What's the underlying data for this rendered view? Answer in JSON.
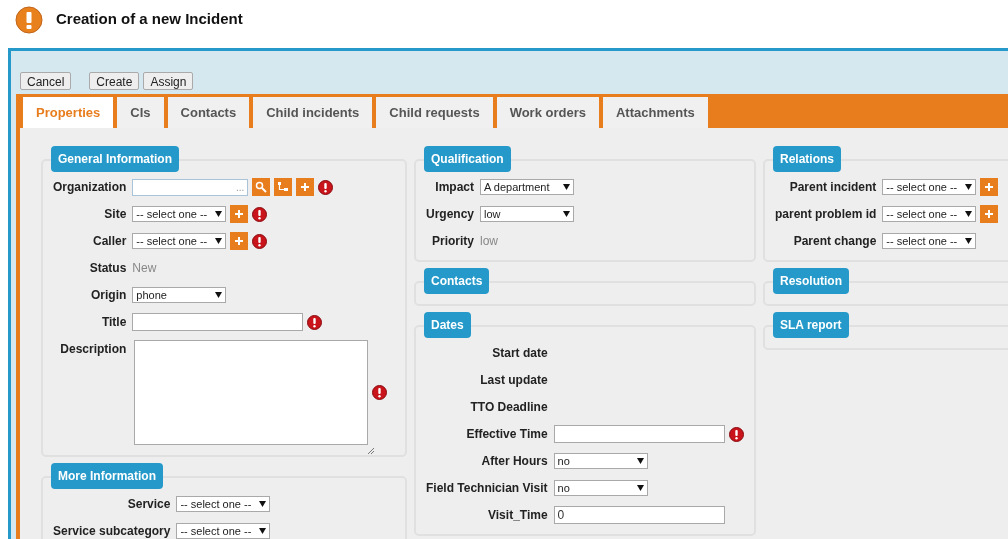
{
  "header": {
    "title": "Creation of a new Incident"
  },
  "toolbar": {
    "groups": [
      [
        "Cancel"
      ],
      [
        "Create",
        "Assign"
      ]
    ]
  },
  "tabs": [
    {
      "label": "Properties",
      "selected": true
    },
    {
      "label": "CIs",
      "selected": false
    },
    {
      "label": "Contacts",
      "selected": false
    },
    {
      "label": "Child incidents",
      "selected": false
    },
    {
      "label": "Child requests",
      "selected": false
    },
    {
      "label": "Work orders",
      "selected": false
    },
    {
      "label": "Attachments",
      "selected": false
    }
  ],
  "columns": [
    [
      {
        "title": "General Information",
        "fields": [
          {
            "label": "Organization",
            "kind": "lookup",
            "suffix": "...",
            "actions": [
              {
                "kind": "search"
              },
              {
                "kind": "tree"
              },
              {
                "kind": "add"
              }
            ],
            "required": true
          },
          {
            "label": "Site",
            "kind": "select",
            "value": "-- select one --",
            "actions": [
              {
                "kind": "add"
              }
            ],
            "required": true
          },
          {
            "label": "Caller",
            "kind": "select",
            "value": "-- select one --",
            "actions": [
              {
                "kind": "add"
              }
            ],
            "required": true
          },
          {
            "label": "Status",
            "kind": "value",
            "value": "New",
            "required": false
          },
          {
            "label": "Origin",
            "kind": "select",
            "value": "phone",
            "required": false
          },
          {
            "label": "Title",
            "kind": "text",
            "required": true
          },
          {
            "label": "Description",
            "kind": "textarea",
            "required": true
          }
        ]
      },
      {
        "title": "More Information",
        "fields": [
          {
            "label": "Service",
            "kind": "select",
            "value": "-- select one --",
            "required": false
          },
          {
            "label": "Service subcategory",
            "kind": "select",
            "value": "-- select one --",
            "required": false
          }
        ]
      }
    ],
    [
      {
        "title": "Qualification",
        "fields": [
          {
            "label": "Impact",
            "kind": "select",
            "value": "A department",
            "required": false
          },
          {
            "label": "Urgency",
            "kind": "select",
            "value": "low",
            "required": false
          },
          {
            "label": "Priority",
            "kind": "value",
            "value": "low",
            "required": false
          }
        ]
      },
      {
        "title": "Contacts"
      },
      {
        "title": "Dates",
        "fields": [
          {
            "label": "Start date",
            "kind": "value",
            "required": false
          },
          {
            "label": "Last update",
            "kind": "value",
            "required": false
          },
          {
            "label": "TTO Deadline",
            "kind": "value",
            "required": false
          },
          {
            "label": "Effective Time",
            "kind": "text",
            "required": true
          },
          {
            "label": "After Hours",
            "kind": "select",
            "value": "no",
            "required": false
          },
          {
            "label": "Field Technician Visit",
            "kind": "select",
            "value": "no",
            "required": false
          },
          {
            "label": "Visit_Time",
            "kind": "text",
            "value": "0",
            "required": false
          }
        ]
      }
    ],
    [
      {
        "title": "Relations",
        "fields": [
          {
            "label": "Parent incident",
            "kind": "select",
            "value": "-- select one --",
            "actions": [
              {
                "kind": "add"
              }
            ],
            "required": false
          },
          {
            "label": "parent problem id",
            "kind": "select",
            "value": "-- select one --",
            "actions": [
              {
                "kind": "add"
              }
            ],
            "required": false
          },
          {
            "label": "Parent change",
            "kind": "select",
            "value": "-- select one --",
            "required": false
          }
        ]
      },
      {
        "title": "Resolution"
      },
      {
        "title": "SLA report"
      }
    ]
  ]
}
